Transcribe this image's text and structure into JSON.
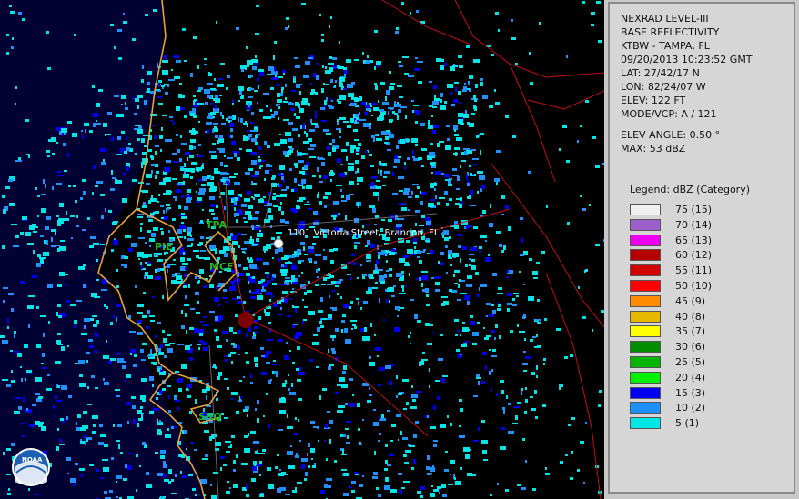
{
  "info": {
    "product": "NEXRAD LEVEL-III",
    "type": "BASE REFLECTIVITY",
    "station": "KTBW - TAMPA, FL",
    "datetime": "09/20/2013 10:23:52 GMT",
    "lat": "LAT: 27/42/17 N",
    "lon": "LON: 82/24/07 W",
    "elev": "ELEV: 122 FT",
    "mode": "MODE/VCP: A / 121",
    "elev_angle": "ELEV ANGLE: 0.50 °",
    "max": "MAX: 53 dBZ"
  },
  "legend": {
    "title": "Legend: dBZ (Category)",
    "entries": [
      {
        "label": "75  (15)",
        "color": "#f0f0f0"
      },
      {
        "label": "70  (14)",
        "color": "#9a5fc8"
      },
      {
        "label": "65  (13)",
        "color": "#f000f0"
      },
      {
        "label": "60  (12)",
        "color": "#b40000"
      },
      {
        "label": "55  (11)",
        "color": "#d00000"
      },
      {
        "label": "50  (10)",
        "color": "#ff0000"
      },
      {
        "label": "45  (9)",
        "color": "#ff8c00"
      },
      {
        "label": "40  (8)",
        "color": "#e6b800"
      },
      {
        "label": "35  (7)",
        "color": "#ffff00"
      },
      {
        "label": "30  (6)",
        "color": "#008c00"
      },
      {
        "label": "25  (5)",
        "color": "#00b400"
      },
      {
        "label": "20  (4)",
        "color": "#00f000"
      },
      {
        "label": "15  (3)",
        "color": "#0000f0"
      },
      {
        "label": "10  (2)",
        "color": "#1e90ff"
      },
      {
        "label": "5  (1)",
        "color": "#00e6e6"
      }
    ]
  },
  "map": {
    "address_label": "1101 Victoria Street, Brandon, FL",
    "sites": [
      {
        "code": "TPA"
      },
      {
        "code": "PIE"
      },
      {
        "code": "MCF"
      },
      {
        "code": "SRQ"
      }
    ],
    "logo_text": "NOAA",
    "colors": {
      "water": "#000033",
      "land": "#000000",
      "coast": "#e6a23c",
      "roads": "#c01010",
      "radar": "#00e6e6"
    }
  }
}
